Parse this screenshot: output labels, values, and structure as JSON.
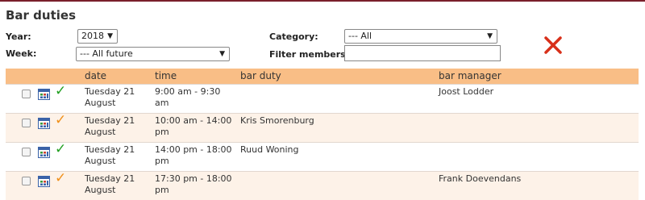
{
  "page": {
    "title": "Bar duties"
  },
  "filters": {
    "year_label": "Year:",
    "year_value": "2018",
    "week_label": "Week:",
    "week_value": "--- All future",
    "category_label": "Category:",
    "category_value": "--- All",
    "members_label": "Filter members:",
    "members_value": ""
  },
  "colors": {
    "header_bg": "#f9be86",
    "check_confirmed": "#22a022",
    "check_pending": "#f0901a",
    "clear_x": "#d8301a"
  },
  "icons": {
    "row_calendar": "calendar-icon",
    "confirmed": "check-icon",
    "pending": "check-icon",
    "clear": "close-icon"
  },
  "table": {
    "headers": {
      "date": "date",
      "time": "time",
      "bar_duty": "bar duty",
      "bar_manager": "bar manager"
    },
    "rows": [
      {
        "date": "Tuesday 21 August",
        "time": "9:00 am - 9:30 am",
        "bar_duty": "",
        "bar_manager": "Joost Lodder",
        "status": "confirmed",
        "status_color": "#22a022"
      },
      {
        "date": "Tuesday 21 August",
        "time": "10:00 am - 14:00 pm",
        "bar_duty": "Kris Smorenburg",
        "bar_manager": "",
        "status": "pending",
        "status_color": "#f0901a"
      },
      {
        "date": "Tuesday 21 August",
        "time": "14:00 pm - 18:00 pm",
        "bar_duty": "Ruud Woning",
        "bar_manager": "",
        "status": "confirmed",
        "status_color": "#22a022"
      },
      {
        "date": "Tuesday 21 August",
        "time": "17:30 pm - 18:00 pm",
        "bar_duty": "",
        "bar_manager": "Frank Doevendans",
        "status": "pending",
        "status_color": "#f0901a"
      }
    ]
  }
}
